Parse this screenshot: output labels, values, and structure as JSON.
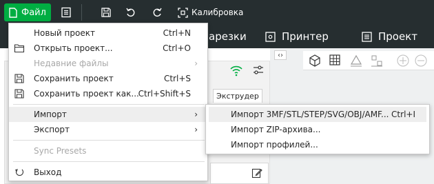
{
  "colors": {
    "accent": "#00ae42",
    "toolbar_bg": "#262e30",
    "highlight": "#eeeeee",
    "disabled_text": "#a8a8a8"
  },
  "toolbar": {
    "file_label": "Файл",
    "calibration_label": "Калибровка",
    "icons": [
      "file-icon",
      "menu-icon",
      "save-icon",
      "undo-icon",
      "redo-icon",
      "calibration-icon"
    ]
  },
  "nav": {
    "slicing_label": "арезки",
    "printer_label": "Принтер",
    "project_label": "Проект"
  },
  "panel": {
    "extruder_tab": "Экструдер"
  },
  "file_menu": {
    "items": [
      {
        "label": "Новый проект",
        "shortcut": "Ctrl+N",
        "icon": ""
      },
      {
        "label": "Открыть проект...",
        "shortcut": "Ctrl+O",
        "icon": "folder-icon"
      },
      {
        "label": "Недавние файлы",
        "shortcut": "",
        "icon": ""
      },
      {
        "label": "Сохранить проект",
        "shortcut": "Ctrl+S",
        "icon": "save-icon"
      },
      {
        "label": "Сохранить проект как...",
        "shortcut": "Ctrl+Shift+S",
        "icon": "save-as-icon"
      },
      {
        "label": "Импорт",
        "shortcut": "",
        "icon": ""
      },
      {
        "label": "Экспорт",
        "shortcut": "",
        "icon": ""
      },
      {
        "label": "Sync Presets",
        "shortcut": "",
        "icon": ""
      },
      {
        "label": "Выход",
        "shortcut": "",
        "icon": "exit-icon"
      }
    ]
  },
  "import_submenu": {
    "items": [
      {
        "label": "Импорт 3MF/STL/STEP/SVG/OBJ/AMF...",
        "shortcut": "Ctrl+I"
      },
      {
        "label": "Импорт ZIP-архива...",
        "shortcut": ""
      },
      {
        "label": "Импорт профилей...",
        "shortcut": ""
      }
    ]
  }
}
